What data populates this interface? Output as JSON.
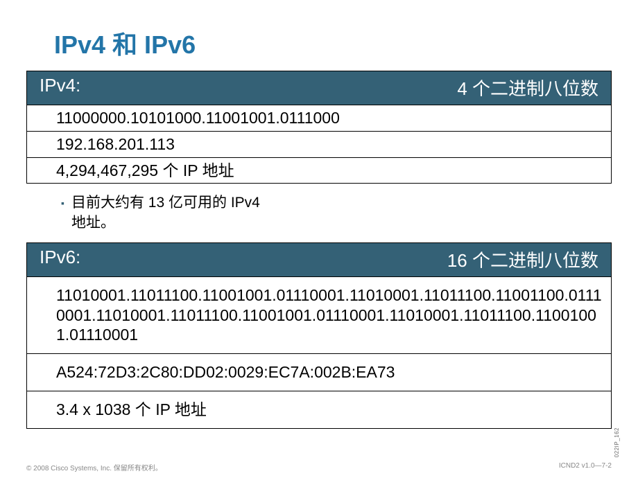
{
  "title": "IPv4 和 IPv6",
  "ipv4": {
    "header_left": "IPv4:",
    "header_right": "4 个二进制八位数",
    "rows": [
      "11000000.10101000.11001001.0111000",
      "192.168.201.113",
      "4,294,467,295 个 IP 地址"
    ]
  },
  "bullet": {
    "text": "目前大约有 13 亿可用的 IPv4\n地址。"
  },
  "ipv6": {
    "header_left": "IPv6:",
    "header_right": "16 个二进制八位数",
    "rows": [
      "11010001.11011100.11001001.01110001.11010001.11011100.11001100.01110001.11010001.11011100.11001001.01110001.11010001.11011100.11001001.01110001",
      "A524:72D3:2C80:DD02:0029:EC7A:002B:EA73",
      "3.4 x 1038 个 IP 地址"
    ]
  },
  "footer": {
    "left": "© 2008 Cisco Systems, Inc. 保留所有权利。",
    "right": "ICND2 v1.0—7-2"
  },
  "side_label": "022IP_162"
}
